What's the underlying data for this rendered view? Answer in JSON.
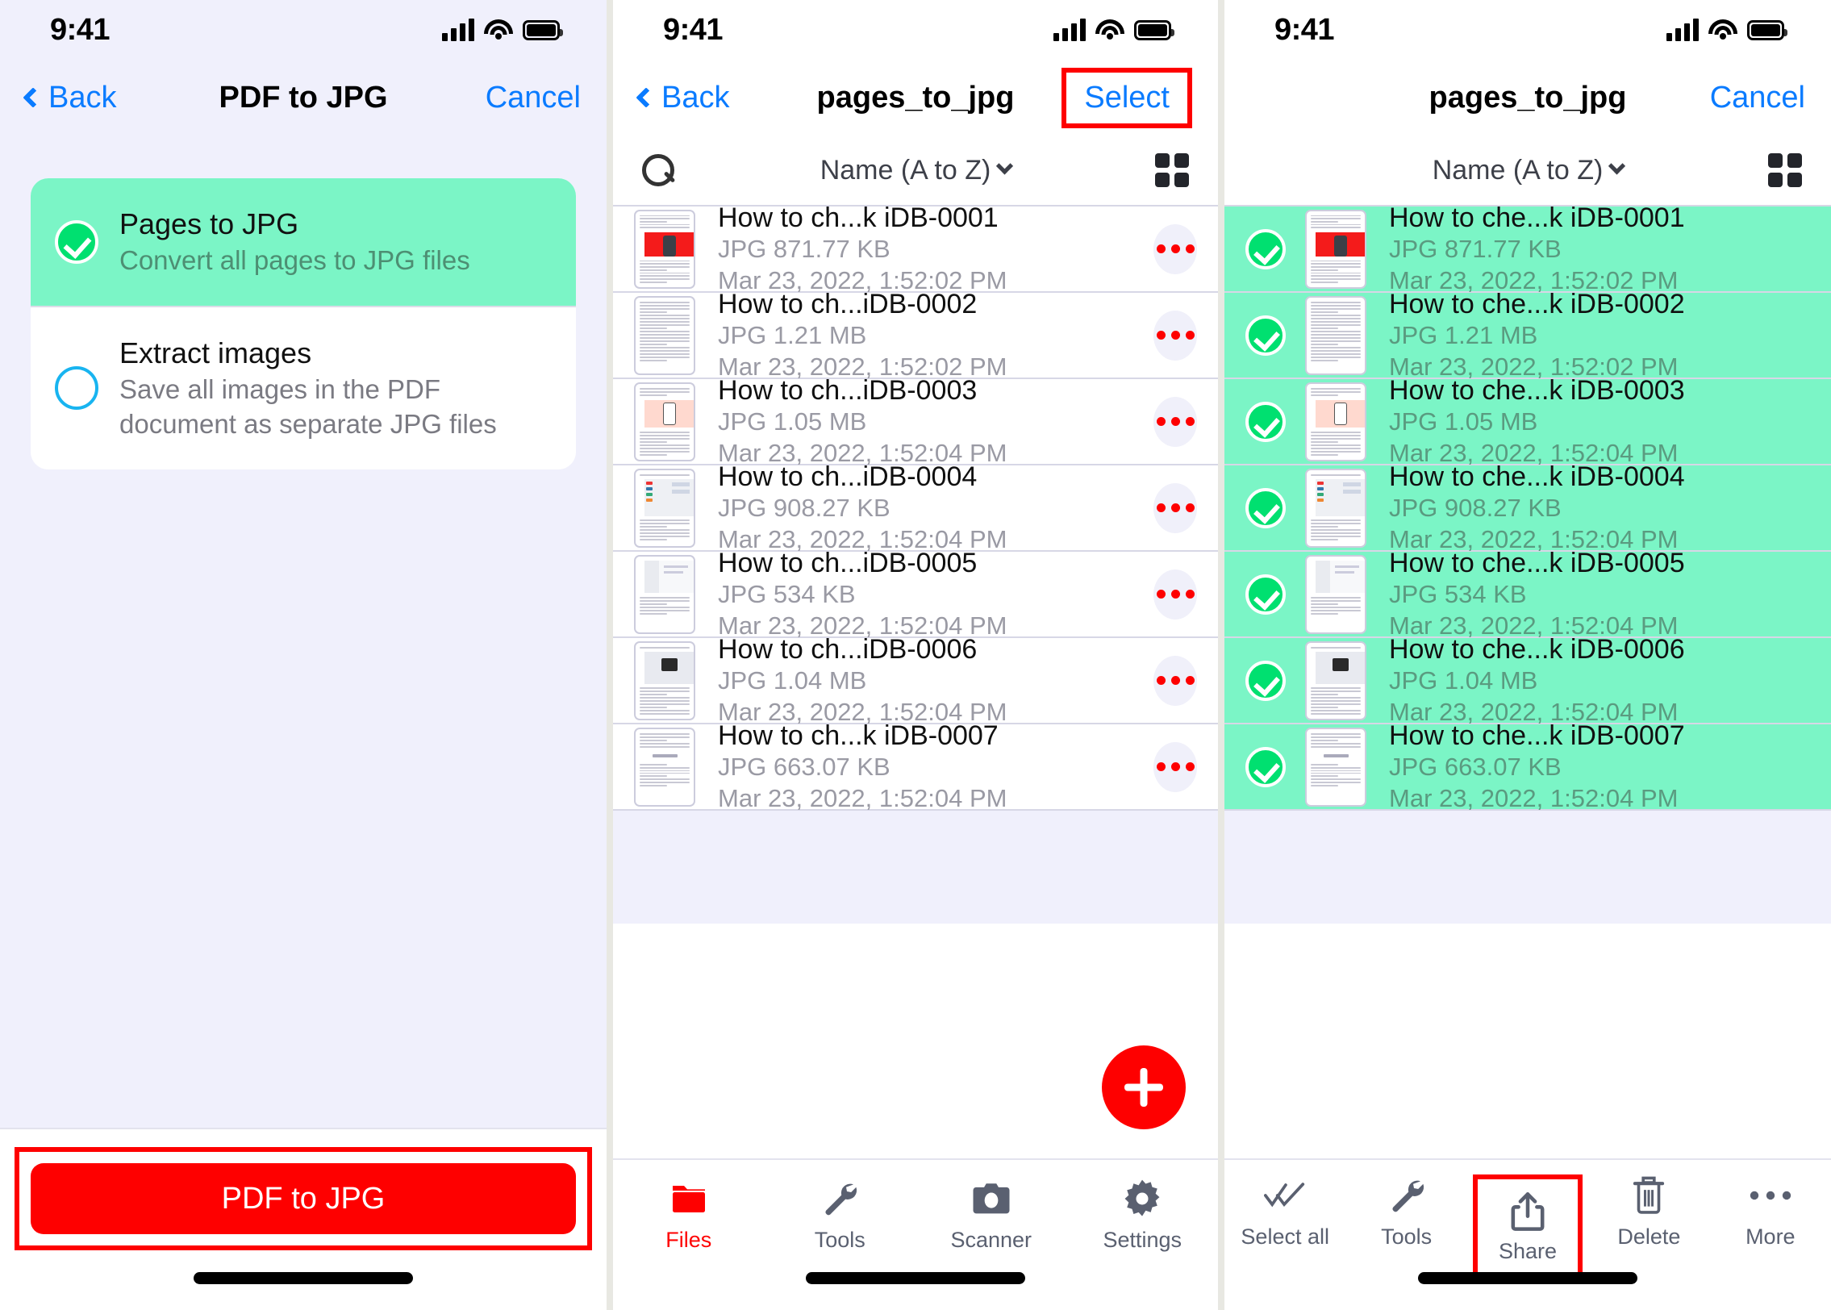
{
  "status_bar": {
    "time": "9:41"
  },
  "colors": {
    "accent_red": "#fe0000",
    "accent_blue": "#0a7bff",
    "selection_green": "#7bf5c6",
    "check_green": "#00e070",
    "page_bg": "#f0f0fc"
  },
  "panel1": {
    "nav": {
      "back_label": "Back",
      "title": "PDF to JPG",
      "right_label": "Cancel"
    },
    "options": [
      {
        "title": "Pages to JPG",
        "subtitle": "Convert all pages to JPG files",
        "selected": true
      },
      {
        "title": "Extract images",
        "subtitle": "Save all images in the PDF document as separate JPG files",
        "selected": false
      }
    ],
    "cta_label": "PDF to JPG"
  },
  "panel2": {
    "nav": {
      "back_label": "Back",
      "title": "pages_to_jpg",
      "right_label": "Select",
      "right_highlighted": true
    },
    "toolbar": {
      "search_icon": "search-icon",
      "sort_label": "Name (A to Z)",
      "grid_icon": "grid-view-icon"
    },
    "files": [
      {
        "name": "How to ch...k iDB-0001",
        "size": "JPG 871.77 KB",
        "date": "Mar 23, 2022, 1:52:02 PM"
      },
      {
        "name": "How to ch...iDB-0002",
        "size": "JPG 1.21 MB",
        "date": "Mar 23, 2022, 1:52:02 PM"
      },
      {
        "name": "How to ch...iDB-0003",
        "size": "JPG 1.05 MB",
        "date": "Mar 23, 2022, 1:52:04 PM"
      },
      {
        "name": "How to ch...iDB-0004",
        "size": "JPG 908.27 KB",
        "date": "Mar 23, 2022, 1:52:04 PM"
      },
      {
        "name": "How to ch...iDB-0005",
        "size": "JPG 534 KB",
        "date": "Mar 23, 2022, 1:52:04 PM"
      },
      {
        "name": "How to ch...iDB-0006",
        "size": "JPG 1.04 MB",
        "date": "Mar 23, 2022, 1:52:04 PM"
      },
      {
        "name": "How to ch...k iDB-0007",
        "size": "JPG 663.07 KB",
        "date": "Mar 23, 2022, 1:52:04 PM"
      }
    ],
    "fab": {
      "icon": "plus-icon"
    },
    "tabs": [
      {
        "label": "Files",
        "icon": "folder-icon",
        "active": true
      },
      {
        "label": "Tools",
        "icon": "wrench-icon",
        "active": false
      },
      {
        "label": "Scanner",
        "icon": "camera-icon",
        "active": false
      },
      {
        "label": "Settings",
        "icon": "gear-icon",
        "active": false
      }
    ]
  },
  "panel3": {
    "nav": {
      "title": "pages_to_jpg",
      "right_label": "Cancel"
    },
    "toolbar": {
      "sort_label": "Name (A to Z)",
      "grid_icon": "grid-view-icon"
    },
    "files": [
      {
        "name": "How to che...k iDB-0001",
        "size": "JPG 871.77 KB",
        "date": "Mar 23, 2022, 1:52:02 PM",
        "selected": true
      },
      {
        "name": "How to che...k iDB-0002",
        "size": "JPG 1.21 MB",
        "date": "Mar 23, 2022, 1:52:02 PM",
        "selected": true
      },
      {
        "name": "How to che...k iDB-0003",
        "size": "JPG 1.05 MB",
        "date": "Mar 23, 2022, 1:52:04 PM",
        "selected": true
      },
      {
        "name": "How to che...k iDB-0004",
        "size": "JPG 908.27 KB",
        "date": "Mar 23, 2022, 1:52:04 PM",
        "selected": true
      },
      {
        "name": "How to che...k iDB-0005",
        "size": "JPG 534 KB",
        "date": "Mar 23, 2022, 1:52:04 PM",
        "selected": true
      },
      {
        "name": "How to che...k iDB-0006",
        "size": "JPG 1.04 MB",
        "date": "Mar 23, 2022, 1:52:04 PM",
        "selected": true
      },
      {
        "name": "How to che...k iDB-0007",
        "size": "JPG 663.07 KB",
        "date": "Mar 23, 2022, 1:52:04 PM",
        "selected": true
      }
    ],
    "actions": [
      {
        "label": "Select all",
        "icon": "double-check-icon",
        "highlighted": false
      },
      {
        "label": "Tools",
        "icon": "wrench-icon",
        "highlighted": false
      },
      {
        "label": "Share",
        "icon": "share-icon",
        "highlighted": true
      },
      {
        "label": "Delete",
        "icon": "trash-icon",
        "highlighted": false
      },
      {
        "label": "More",
        "icon": "ellipsis-icon",
        "highlighted": false
      }
    ]
  }
}
